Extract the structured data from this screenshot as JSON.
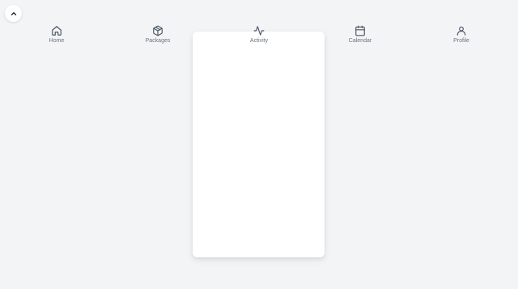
{
  "collapse_button": {
    "icon": "chevron-up-icon"
  },
  "nav": {
    "items": [
      {
        "label": "Home",
        "icon": "home-icon"
      },
      {
        "label": "Packages",
        "icon": "package-icon"
      },
      {
        "label": "Activity",
        "icon": "activity-icon"
      },
      {
        "label": "Calendar",
        "icon": "calendar-icon"
      },
      {
        "label": "Profile",
        "icon": "user-icon"
      }
    ]
  },
  "colors": {
    "background": "#f3f4f6",
    "card": "#ffffff",
    "icon": "#4b5563",
    "label": "#6b7280"
  }
}
